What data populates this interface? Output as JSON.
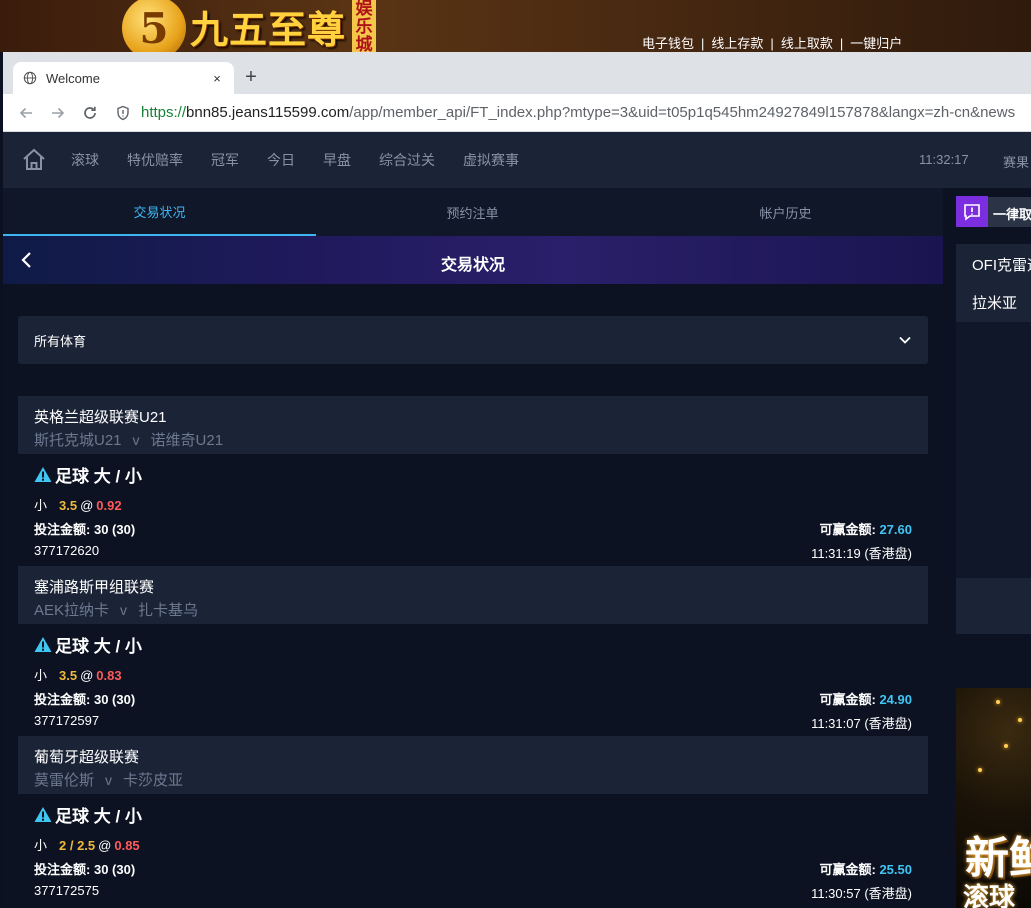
{
  "site": {
    "logo_text": "九五至尊",
    "logo_badge": "娱乐城",
    "links": [
      "电子钱包",
      "线上存款",
      "线上取款",
      "一键归户"
    ],
    "link_sep": "|"
  },
  "browser": {
    "tab_title": "Welcome",
    "tab_close": "×",
    "new_tab": "+",
    "url_scheme": "https://",
    "url_host": "bnn85.jeans115599.com",
    "url_path": "/app/member_api/FT_index.php?mtype=3&uid=t05p1q545hm24927849l157878&langx=zh-cn&news"
  },
  "topnav": {
    "items": [
      "滚球",
      "特优赔率",
      "冠军",
      "今日",
      "早盘",
      "综合过关",
      "虚拟赛事"
    ],
    "clock": "11:32:17",
    "result_label": "赛果"
  },
  "subtabs": [
    "交易状况",
    "预约注单",
    "帐户历史"
  ],
  "header": {
    "title": "交易状况"
  },
  "filter": {
    "selected": "所有体育"
  },
  "bets": [
    {
      "league": "英格兰超级联赛U21",
      "home": "斯托克城U21",
      "vs": "v",
      "away": "诺维奇U21",
      "market": "足球 大 / 小",
      "side": "小",
      "line": "3.5",
      "at": "@",
      "odds": "0.92",
      "stake_label": "投注金额:",
      "stake": "30 (30)",
      "win_label": "可赢金额:",
      "win": "27.60",
      "ticket": "377172620",
      "time": "11:31:19 (香港盘)"
    },
    {
      "league": "塞浦路斯甲组联赛",
      "home": "AEK拉纳卡",
      "vs": "v",
      "away": "扎卡基乌",
      "market": "足球 大 / 小",
      "side": "小",
      "line": "3.5",
      "at": "@",
      "odds": "0.83",
      "stake_label": "投注金额:",
      "stake": "30 (30)",
      "win_label": "可赢金额:",
      "win": "24.90",
      "ticket": "377172597",
      "time": "11:31:07 (香港盘)"
    },
    {
      "league": "葡萄牙超级联赛",
      "home": "莫雷伦斯",
      "vs": "v",
      "away": "卡莎皮亚",
      "market": "足球 大 / 小",
      "side": "小",
      "line": "2 / 2.5",
      "at": "@",
      "odds": "0.85",
      "stake_label": "投注金额:",
      "stake": "30 (30)",
      "win_label": "可赢金额:",
      "win": "25.50",
      "ticket": "377172575",
      "time": "11:30:57 (香港盘)"
    }
  ],
  "right_panel": {
    "top_text": "一律取消",
    "line1": "OFI克雷迪",
    "line2": "拉米亚",
    "promo_big": "新鲜",
    "promo_small": "滚球"
  },
  "colors": {
    "accent_tab": "#3fb5f0",
    "odds_red": "#ff5a5a",
    "line_orange": "#f0b93a",
    "win_cyan": "#3fc6f3",
    "warn_cyan": "#3fc6f3"
  }
}
